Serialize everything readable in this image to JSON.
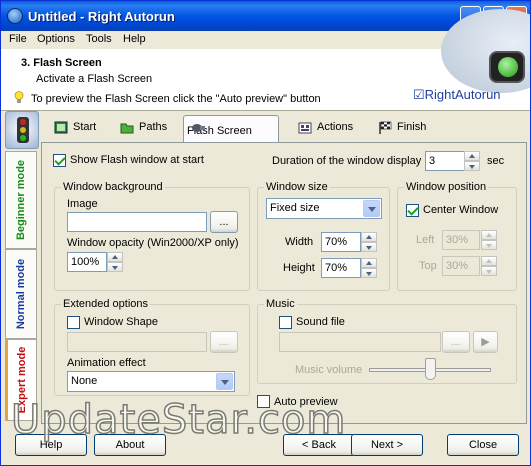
{
  "window": {
    "title": "Untitled - Right Autorun",
    "min": "_",
    "max": "□",
    "close": "✕"
  },
  "menu": [
    "File",
    "Options",
    "Tools",
    "Help"
  ],
  "header": {
    "step": "3. Flash Screen",
    "subtitle": "Activate a Flash Screen",
    "tip": "To preview the Flash Screen click the \"Auto preview\" button",
    "brand": "RightAutorun"
  },
  "modes": [
    "Beginner mode",
    "Normal mode",
    "Expert mode"
  ],
  "tabs": [
    "Start",
    "Paths",
    "Flash Screen",
    "Actions",
    "Finish"
  ],
  "panel": {
    "show_flash": "Show Flash window at start",
    "duration_label": "Duration of the window display",
    "duration_value": "3",
    "duration_unit": "sec",
    "bg_title": "Window background",
    "image_label": "Image",
    "image_value": "",
    "browse": "...",
    "opacity_label": "Window opacity (Win2000/XP only)",
    "opacity_value": "100%",
    "size_title": "Window size",
    "size_select": "Fixed size",
    "width_label": "Width",
    "width_value": "70%",
    "height_label": "Height",
    "height_value": "70%",
    "pos_title": "Window position",
    "center_label": "Center Window",
    "left_label": "Left",
    "left_value": "30%",
    "top_label": "Top",
    "top_value": "30%",
    "ext_title": "Extended options",
    "shape_label": "Window Shape",
    "shape_browse": "...",
    "anim_label": "Animation effect",
    "anim_value": "None",
    "music_title": "Music",
    "sound_label": "Sound file",
    "sound_browse": "...",
    "play": "▶",
    "volume_label": "Music volume",
    "auto_preview": "Auto preview"
  },
  "footer": {
    "help": "Help",
    "about": "About",
    "back": "< Back",
    "next": "Next >",
    "close": "Close"
  },
  "watermark": "UpdateStar.com"
}
